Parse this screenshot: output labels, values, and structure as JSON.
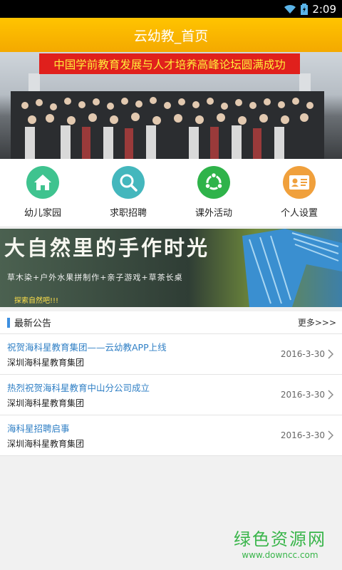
{
  "status": {
    "time": "2:09"
  },
  "header": {
    "title": "云幼教_首页"
  },
  "banner1": {
    "headline": "中国学前教育发展与人才培养高峰论坛圆满成功"
  },
  "nav": [
    {
      "label": "幼儿家园",
      "icon": "house-icon",
      "color": "#3fc38f"
    },
    {
      "label": "求职招聘",
      "icon": "job-search-icon",
      "color": "#44b7bd"
    },
    {
      "label": "课外活动",
      "icon": "ubuntu-circle-icon",
      "color": "#2fb34a"
    },
    {
      "label": "个人设置",
      "icon": "id-card-icon",
      "color": "#f0a03c"
    }
  ],
  "banner2": {
    "calligraphy": "大自然里的手作时光",
    "subtitle": "草木染+户外水果拼制作+亲子游戏+草茶长桌",
    "subtitle2": "探索自然吧!!!"
  },
  "announcements": {
    "title": "最新公告",
    "more": "更多>>>",
    "items": [
      {
        "title": "祝贺海科星教育集团——云幼教APP上线",
        "org": "深圳海科星教育集团",
        "date": "2016-3-30"
      },
      {
        "title": "热烈祝贺海科星教育中山分公司成立",
        "org": "深圳海科星教育集团",
        "date": "2016-3-30"
      },
      {
        "title": "海科星招聘启事",
        "org": "深圳海科星教育集团",
        "date": "2016-3-30"
      }
    ]
  },
  "watermark": {
    "big": "绿色资源网",
    "small": "www.downcc.com"
  }
}
